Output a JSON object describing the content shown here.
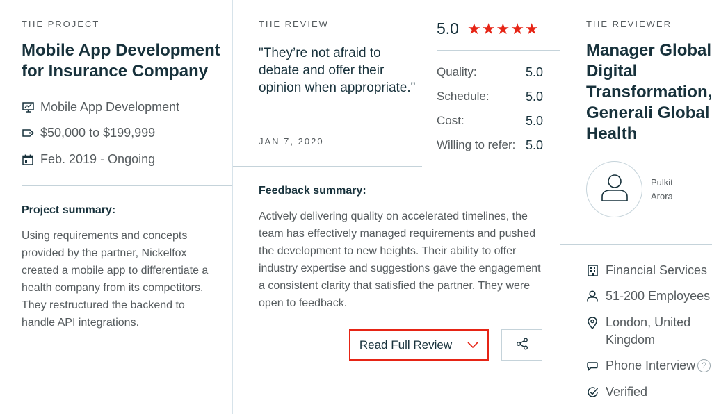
{
  "project": {
    "eyebrow": "THE PROJECT",
    "title": "Mobile App Development for Insurance Company",
    "service": "Mobile App Development",
    "budget": "$50,000 to $199,999",
    "dates": "Feb. 2019 - Ongoing",
    "summary_heading": "Project summary:",
    "summary_text": "Using requirements and concepts provided by the partner, Nickelfox created a mobile app to differentiate a health company from its competitors. They restructured the backend to handle API integrations."
  },
  "review": {
    "eyebrow": "THE REVIEW",
    "quote": "\"They’re not afraid to debate and offer their opinion when appropriate.\"",
    "date": "JAN 7, 2020",
    "overall": "5.0",
    "stars": 5,
    "scores": [
      {
        "label": "Quality:",
        "value": "5.0"
      },
      {
        "label": "Schedule:",
        "value": "5.0"
      },
      {
        "label": "Cost:",
        "value": "5.0"
      },
      {
        "label": "Willing to refer:",
        "value": "5.0"
      }
    ],
    "feedback_heading": "Feedback summary:",
    "feedback_text": "Actively delivering quality on accelerated timelines, the team has effectively managed requirements and pushed the development to new heights. Their ability to offer industry expertise and suggestions gave the engagement a consistent clarity that satisfied the partner. They were open to feedback.",
    "read_full_label": "Read Full Review"
  },
  "reviewer": {
    "eyebrow": "THE REVIEWER",
    "title": "Manager Global Digital Transformation, Generali Global Health",
    "name_first": "Pulkit",
    "name_last": "Arora",
    "industry": "Financial Services",
    "size": "51-200 Employees",
    "location": "London, United Kingdom",
    "interview": "Phone Interview",
    "help": "?",
    "status": "Verified"
  },
  "colors": {
    "accent": "#e62415",
    "text_dark": "#17313b",
    "text_muted": "#555b5e",
    "divider": "#c5d3da"
  }
}
